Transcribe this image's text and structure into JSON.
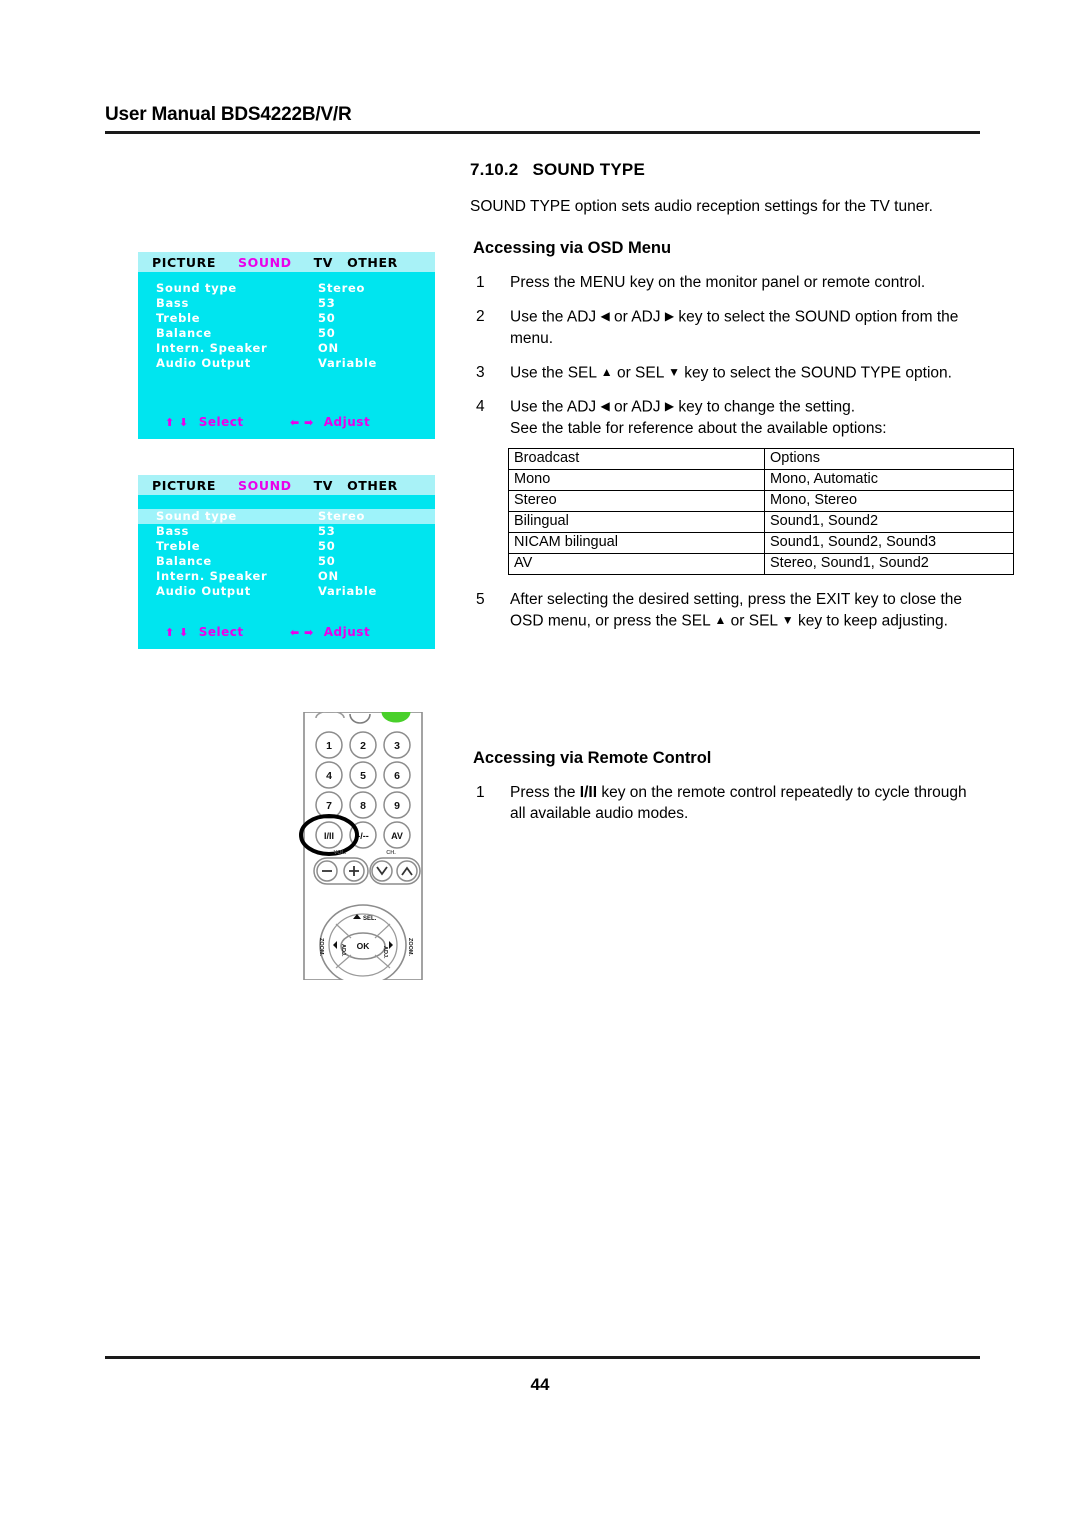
{
  "header": {
    "title": "User Manual BDS4222B/V/R"
  },
  "footer": {
    "page_number": "44"
  },
  "section": {
    "number": "7.10.2",
    "title": "SOUND TYPE",
    "intro": "SOUND TYPE option sets audio reception settings for the TV tuner."
  },
  "osd_section": {
    "heading": "Accessing via OSD Menu",
    "steps": [
      {
        "index": "1",
        "text": "Press the MENU key on the monitor panel or remote control."
      },
      {
        "index": "2",
        "text_a": "Use the ADJ ",
        "arrow_a": "◀",
        "text_b": " or ADJ ",
        "arrow_b": "▶",
        "text_c": " key to select the SOUND option from the menu."
      },
      {
        "index": "3",
        "text_a": "Use the SEL ",
        "arrow_a": "▲",
        "text_b": " or SEL ",
        "arrow_b": "▼",
        "text_c": " key to select the SOUND TYPE option."
      },
      {
        "index": "4",
        "text_a": "Use the ADJ ",
        "arrow_a": "◀",
        "text_b": " or ADJ ",
        "arrow_b": "▶",
        "text_c": " key to change the setting.",
        "text_d": "See the table for reference about the available options:"
      },
      {
        "index": "5",
        "text_a": "After selecting the desired setting, press the EXIT key to close the OSD menu, or press the SEL ",
        "arrow_a": "▲",
        "text_b": " or SEL ",
        "arrow_b": "▼",
        "text_c": " key to keep adjusting."
      }
    ]
  },
  "options_table": {
    "headers": [
      "Broadcast",
      "Options"
    ],
    "rows": [
      [
        "Mono",
        "Mono, Automatic"
      ],
      [
        "Stereo",
        "Mono, Stereo"
      ],
      [
        "Bilingual",
        "Sound1, Sound2"
      ],
      [
        "NICAM bilingual",
        "Sound1, Sound2, Sound3"
      ],
      [
        "AV",
        "Stereo, Sound1, Sound2"
      ]
    ]
  },
  "remote_section": {
    "heading": "Accessing via Remote Control",
    "steps": [
      {
        "index": "1",
        "text_a": "Press the ",
        "bold": "I/II",
        "text_b": " key on the remote control repeatedly to cycle through all available audio modes."
      }
    ]
  },
  "osd_menu": {
    "tabs": [
      {
        "label": "PICTURE",
        "selected": false
      },
      {
        "label": "SOUND",
        "selected": true
      },
      {
        "label": "TV",
        "selected": false
      },
      {
        "label": "OTHER",
        "selected": false
      }
    ],
    "rows": [
      {
        "label": "Sound  type",
        "value": "Stereo"
      },
      {
        "label": "Bass",
        "value": "53"
      },
      {
        "label": "Treble",
        "value": "50"
      },
      {
        "label": "Balance",
        "value": "50"
      },
      {
        "label": "Intern. Speaker",
        "value": "ON"
      },
      {
        "label": "Audio Output",
        "value": "Variable"
      }
    ],
    "hints": {
      "select_glyphs": "⬆ ⬇",
      "select_label": "Select",
      "adjust_glyphs": "⬅ ➡",
      "adjust_label": "Adjust"
    },
    "colors": {
      "body": "#00e5ef",
      "tab_bar": "#a8f2f7",
      "highlight": "#9ef3fa",
      "selected_tab": "#ea00ea",
      "hint": "#ea00ea",
      "label": "#ffffff"
    },
    "highlighted_row_index": 0
  },
  "remote": {
    "keypad": [
      "1",
      "2",
      "3",
      "4",
      "5",
      "6",
      "7",
      "8",
      "9"
    ],
    "function_row": [
      "I/II",
      "-/--",
      "AV"
    ],
    "volume_label": "VOL.",
    "channel_label": "CH.",
    "volume_minus": "−",
    "volume_plus": "+",
    "channel_down": "∨",
    "channel_up": "∧",
    "nav": {
      "sel_label": "SEL.",
      "ok_label": "OK",
      "adj_label": "ADJ.",
      "zoom_label": "ZOOM."
    },
    "highlight_target": "I/II"
  }
}
